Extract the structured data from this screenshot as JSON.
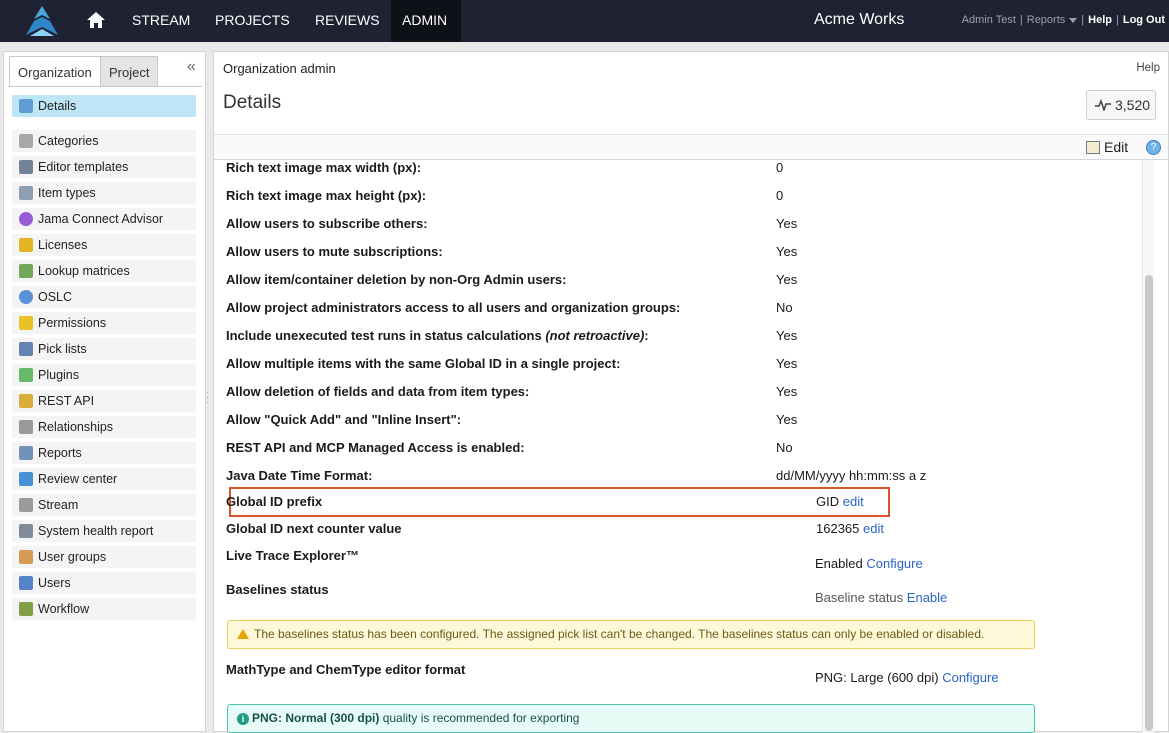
{
  "topbar": {
    "nav": [
      "STREAM",
      "PROJECTS",
      "REVIEWS",
      "ADMIN"
    ],
    "brand": "Acme Works",
    "user": "Admin Test",
    "reports": "Reports",
    "help": "Help",
    "logout": "Log Out"
  },
  "sidebar": {
    "tabs": [
      "Organization",
      "Project"
    ],
    "collapse_glyph": "«",
    "items": [
      {
        "label": "Details",
        "icon": "details-icon",
        "color": "#4f8fcf"
      },
      {
        "label": "Categories",
        "icon": "tag-icon",
        "color": "#9a9a9a"
      },
      {
        "label": "Editor templates",
        "icon": "template-icon",
        "color": "#5b6f86"
      },
      {
        "label": "Item types",
        "icon": "item-types-icon",
        "color": "#7d8fa6"
      },
      {
        "label": "Jama Connect Advisor",
        "icon": "advisor-icon",
        "color": "#8a3fd1"
      },
      {
        "label": "Licenses",
        "icon": "key-icon",
        "color": "#e0a800"
      },
      {
        "label": "Lookup matrices",
        "icon": "matrix-icon",
        "color": "#5a9a3d"
      },
      {
        "label": "OSLC",
        "icon": "oslc-icon",
        "color": "#3b7fd4"
      },
      {
        "label": "Permissions",
        "icon": "shield-icon",
        "color": "#e6b800"
      },
      {
        "label": "Pick lists",
        "icon": "list-icon",
        "color": "#4a6fa5"
      },
      {
        "label": "Plugins",
        "icon": "puzzle-icon",
        "color": "#4caf50"
      },
      {
        "label": "REST API",
        "icon": "api-key-icon",
        "color": "#d4a017"
      },
      {
        "label": "Relationships",
        "icon": "link-icon",
        "color": "#888888"
      },
      {
        "label": "Reports",
        "icon": "report-icon",
        "color": "#5a7fb0"
      },
      {
        "label": "Review center",
        "icon": "review-icon",
        "color": "#2a7fd0"
      },
      {
        "label": "Stream",
        "icon": "stream-icon",
        "color": "#8a8a8a"
      },
      {
        "label": "System health report",
        "icon": "health-icon",
        "color": "#6a7a8a"
      },
      {
        "label": "User groups",
        "icon": "user-groups-icon",
        "color": "#d08a3a"
      },
      {
        "label": "Users",
        "icon": "user-icon",
        "color": "#3a6fc0"
      },
      {
        "label": "Workflow",
        "icon": "workflow-icon",
        "color": "#6b8e23"
      }
    ]
  },
  "main": {
    "breadcrumb": "Organization admin",
    "help": "Help",
    "title": "Details",
    "counter": "3,520",
    "edit": "Edit",
    "help_glyph": "?",
    "settings": [
      {
        "label": "Rich text image max width (px):",
        "value": "0"
      },
      {
        "label": "Rich text image max height (px):",
        "value": "0"
      },
      {
        "label": "Allow users to subscribe others:",
        "value": "Yes"
      },
      {
        "label": "Allow users to mute subscriptions:",
        "value": "Yes"
      },
      {
        "label": "Allow item/container deletion by non-Org Admin users:",
        "value": "Yes"
      },
      {
        "label": "Allow project administrators access to all users and organization groups:",
        "value": "No"
      },
      {
        "label": "Include unexecuted test runs in status calculations ",
        "label_italic": "(not retroactive)",
        "label_tail": ":",
        "value": "Yes"
      },
      {
        "label": "Allow multiple items with the same Global ID in a single project:",
        "value": "Yes"
      },
      {
        "label": "Allow deletion of fields and data from item types:",
        "value": "Yes"
      },
      {
        "label": "Allow \"Quick Add\" and \"Inline Insert\":",
        "value": "Yes"
      },
      {
        "label": "REST API and MCP Managed Access is enabled:",
        "value": "No"
      },
      {
        "label": "Java Date Time Format:",
        "value": "dd/MM/yyyy hh:mm:ss a z"
      }
    ],
    "gid_prefix": {
      "label": "Global ID prefix",
      "value": "GID",
      "link": "edit"
    },
    "gid_counter": {
      "label": "Global ID next counter value",
      "value": "162365",
      "link": "edit"
    },
    "live_trace": {
      "label": "Live Trace Explorer™",
      "value": "Enabled",
      "link": "Configure"
    },
    "baselines": {
      "label": "Baselines status",
      "value": "Baseline status",
      "link": "Enable"
    },
    "baselines_warning": "The baselines status has been configured. The assigned pick list can't be changed. The baselines status can only be enabled or disabled.",
    "mathtype": {
      "label": "MathType and ChemType editor format",
      "value": "PNG: Large (600 dpi)",
      "link": "Configure"
    },
    "info_bold": "PNG: Normal (300 dpi)",
    "info_rest": " quality is recommended for exporting",
    "info_glyph": "i"
  }
}
